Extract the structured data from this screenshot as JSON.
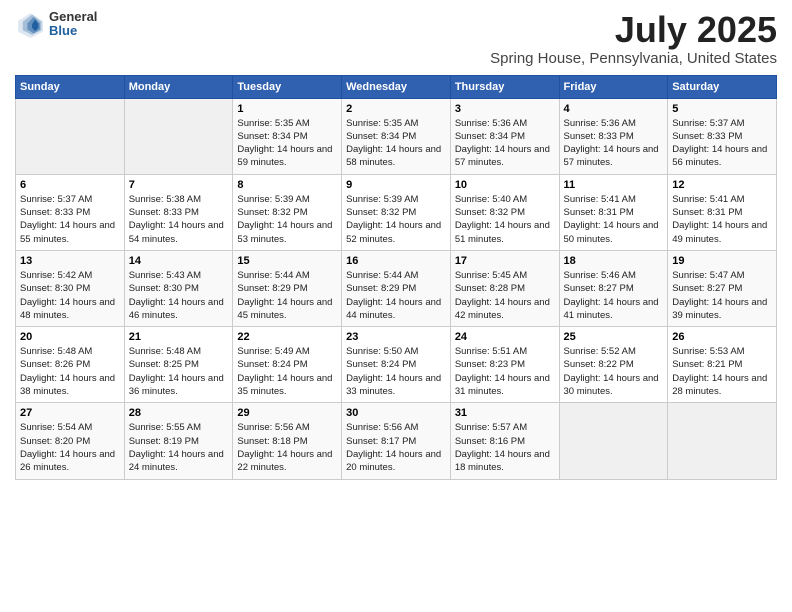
{
  "logo": {
    "general": "General",
    "blue": "Blue"
  },
  "title": "July 2025",
  "subtitle": "Spring House, Pennsylvania, United States",
  "days_of_week": [
    "Sunday",
    "Monday",
    "Tuesday",
    "Wednesday",
    "Thursday",
    "Friday",
    "Saturday"
  ],
  "weeks": [
    [
      {
        "day": "",
        "sunrise": "",
        "sunset": "",
        "daylight": "",
        "empty": true
      },
      {
        "day": "",
        "sunrise": "",
        "sunset": "",
        "daylight": "",
        "empty": true
      },
      {
        "day": "1",
        "sunrise": "Sunrise: 5:35 AM",
        "sunset": "Sunset: 8:34 PM",
        "daylight": "Daylight: 14 hours and 59 minutes."
      },
      {
        "day": "2",
        "sunrise": "Sunrise: 5:35 AM",
        "sunset": "Sunset: 8:34 PM",
        "daylight": "Daylight: 14 hours and 58 minutes."
      },
      {
        "day": "3",
        "sunrise": "Sunrise: 5:36 AM",
        "sunset": "Sunset: 8:34 PM",
        "daylight": "Daylight: 14 hours and 57 minutes."
      },
      {
        "day": "4",
        "sunrise": "Sunrise: 5:36 AM",
        "sunset": "Sunset: 8:33 PM",
        "daylight": "Daylight: 14 hours and 57 minutes."
      },
      {
        "day": "5",
        "sunrise": "Sunrise: 5:37 AM",
        "sunset": "Sunset: 8:33 PM",
        "daylight": "Daylight: 14 hours and 56 minutes."
      }
    ],
    [
      {
        "day": "6",
        "sunrise": "Sunrise: 5:37 AM",
        "sunset": "Sunset: 8:33 PM",
        "daylight": "Daylight: 14 hours and 55 minutes."
      },
      {
        "day": "7",
        "sunrise": "Sunrise: 5:38 AM",
        "sunset": "Sunset: 8:33 PM",
        "daylight": "Daylight: 14 hours and 54 minutes."
      },
      {
        "day": "8",
        "sunrise": "Sunrise: 5:39 AM",
        "sunset": "Sunset: 8:32 PM",
        "daylight": "Daylight: 14 hours and 53 minutes."
      },
      {
        "day": "9",
        "sunrise": "Sunrise: 5:39 AM",
        "sunset": "Sunset: 8:32 PM",
        "daylight": "Daylight: 14 hours and 52 minutes."
      },
      {
        "day": "10",
        "sunrise": "Sunrise: 5:40 AM",
        "sunset": "Sunset: 8:32 PM",
        "daylight": "Daylight: 14 hours and 51 minutes."
      },
      {
        "day": "11",
        "sunrise": "Sunrise: 5:41 AM",
        "sunset": "Sunset: 8:31 PM",
        "daylight": "Daylight: 14 hours and 50 minutes."
      },
      {
        "day": "12",
        "sunrise": "Sunrise: 5:41 AM",
        "sunset": "Sunset: 8:31 PM",
        "daylight": "Daylight: 14 hours and 49 minutes."
      }
    ],
    [
      {
        "day": "13",
        "sunrise": "Sunrise: 5:42 AM",
        "sunset": "Sunset: 8:30 PM",
        "daylight": "Daylight: 14 hours and 48 minutes."
      },
      {
        "day": "14",
        "sunrise": "Sunrise: 5:43 AM",
        "sunset": "Sunset: 8:30 PM",
        "daylight": "Daylight: 14 hours and 46 minutes."
      },
      {
        "day": "15",
        "sunrise": "Sunrise: 5:44 AM",
        "sunset": "Sunset: 8:29 PM",
        "daylight": "Daylight: 14 hours and 45 minutes."
      },
      {
        "day": "16",
        "sunrise": "Sunrise: 5:44 AM",
        "sunset": "Sunset: 8:29 PM",
        "daylight": "Daylight: 14 hours and 44 minutes."
      },
      {
        "day": "17",
        "sunrise": "Sunrise: 5:45 AM",
        "sunset": "Sunset: 8:28 PM",
        "daylight": "Daylight: 14 hours and 42 minutes."
      },
      {
        "day": "18",
        "sunrise": "Sunrise: 5:46 AM",
        "sunset": "Sunset: 8:27 PM",
        "daylight": "Daylight: 14 hours and 41 minutes."
      },
      {
        "day": "19",
        "sunrise": "Sunrise: 5:47 AM",
        "sunset": "Sunset: 8:27 PM",
        "daylight": "Daylight: 14 hours and 39 minutes."
      }
    ],
    [
      {
        "day": "20",
        "sunrise": "Sunrise: 5:48 AM",
        "sunset": "Sunset: 8:26 PM",
        "daylight": "Daylight: 14 hours and 38 minutes."
      },
      {
        "day": "21",
        "sunrise": "Sunrise: 5:48 AM",
        "sunset": "Sunset: 8:25 PM",
        "daylight": "Daylight: 14 hours and 36 minutes."
      },
      {
        "day": "22",
        "sunrise": "Sunrise: 5:49 AM",
        "sunset": "Sunset: 8:24 PM",
        "daylight": "Daylight: 14 hours and 35 minutes."
      },
      {
        "day": "23",
        "sunrise": "Sunrise: 5:50 AM",
        "sunset": "Sunset: 8:24 PM",
        "daylight": "Daylight: 14 hours and 33 minutes."
      },
      {
        "day": "24",
        "sunrise": "Sunrise: 5:51 AM",
        "sunset": "Sunset: 8:23 PM",
        "daylight": "Daylight: 14 hours and 31 minutes."
      },
      {
        "day": "25",
        "sunrise": "Sunrise: 5:52 AM",
        "sunset": "Sunset: 8:22 PM",
        "daylight": "Daylight: 14 hours and 30 minutes."
      },
      {
        "day": "26",
        "sunrise": "Sunrise: 5:53 AM",
        "sunset": "Sunset: 8:21 PM",
        "daylight": "Daylight: 14 hours and 28 minutes."
      }
    ],
    [
      {
        "day": "27",
        "sunrise": "Sunrise: 5:54 AM",
        "sunset": "Sunset: 8:20 PM",
        "daylight": "Daylight: 14 hours and 26 minutes."
      },
      {
        "day": "28",
        "sunrise": "Sunrise: 5:55 AM",
        "sunset": "Sunset: 8:19 PM",
        "daylight": "Daylight: 14 hours and 24 minutes."
      },
      {
        "day": "29",
        "sunrise": "Sunrise: 5:56 AM",
        "sunset": "Sunset: 8:18 PM",
        "daylight": "Daylight: 14 hours and 22 minutes."
      },
      {
        "day": "30",
        "sunrise": "Sunrise: 5:56 AM",
        "sunset": "Sunset: 8:17 PM",
        "daylight": "Daylight: 14 hours and 20 minutes."
      },
      {
        "day": "31",
        "sunrise": "Sunrise: 5:57 AM",
        "sunset": "Sunset: 8:16 PM",
        "daylight": "Daylight: 14 hours and 18 minutes."
      },
      {
        "day": "",
        "sunrise": "",
        "sunset": "",
        "daylight": "",
        "empty": true
      },
      {
        "day": "",
        "sunrise": "",
        "sunset": "",
        "daylight": "",
        "empty": true
      }
    ]
  ]
}
